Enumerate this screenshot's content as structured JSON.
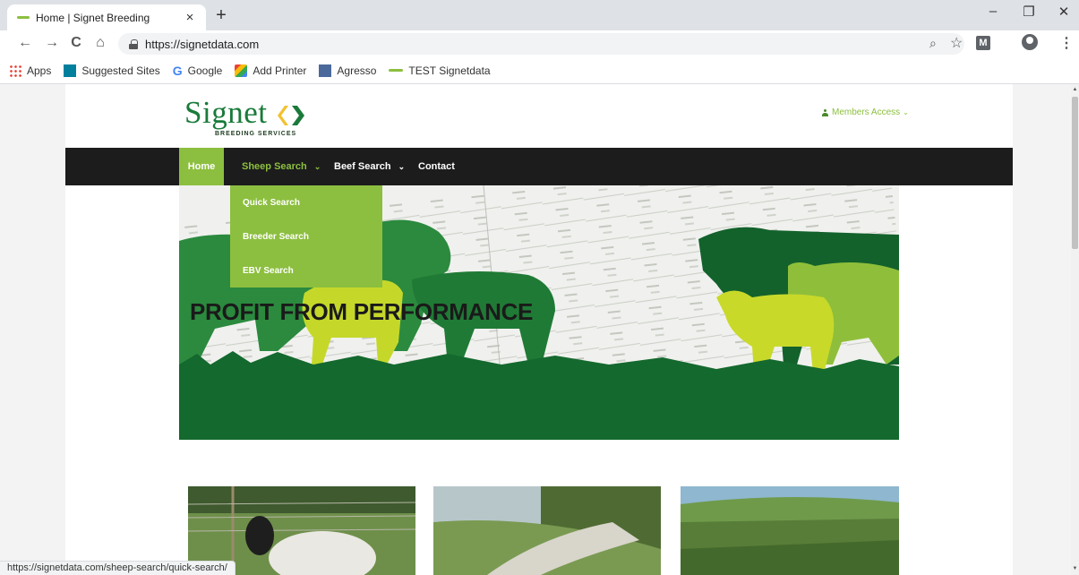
{
  "browser": {
    "tab_title": "Home | Signet Breeding",
    "tab_close": "×",
    "new_tab": "+",
    "url": "https://signetdata.com",
    "status_url": "https://signetdata.com/sheep-search/quick-search/",
    "window": {
      "minimize": "–",
      "restore": "❐",
      "close": "✕"
    },
    "nav": {
      "back": "←",
      "forward": "→",
      "reload": "C",
      "home": "⌂"
    },
    "omnibox_icons": {
      "zoom": "⌕",
      "star": "☆"
    },
    "extension_label": "M",
    "menu": "⋮"
  },
  "bookmarks": [
    {
      "label": "Apps",
      "icon": "apps-grid-icon"
    },
    {
      "label": "Suggested Sites",
      "icon": "bing-icon"
    },
    {
      "label": "Google",
      "icon": "google-icon"
    },
    {
      "label": "Add Printer",
      "icon": "printer-icon"
    },
    {
      "label": "Agresso",
      "icon": "agresso-icon"
    },
    {
      "label": "TEST Signetdata",
      "icon": "signet-icon"
    }
  ],
  "site": {
    "logo_word": "Signet",
    "logo_sub": "BREEDING SERVICES",
    "members_access": "Members Access",
    "nav": [
      {
        "label": "Home",
        "active": true
      },
      {
        "label": "Sheep Search",
        "dropdown": true
      },
      {
        "label": "Beef Search",
        "dropdown": true
      },
      {
        "label": "Contact"
      }
    ],
    "sheep_dropdown": [
      "Quick Search",
      "Breeder Search",
      "EBV Search"
    ],
    "hero_title": "PROFIT FROM PERFORMANCE",
    "colors": {
      "brand_green": "#8cbf3f",
      "dark_green": "#1a7a3a",
      "nav_bg": "#1c1c1c"
    }
  }
}
